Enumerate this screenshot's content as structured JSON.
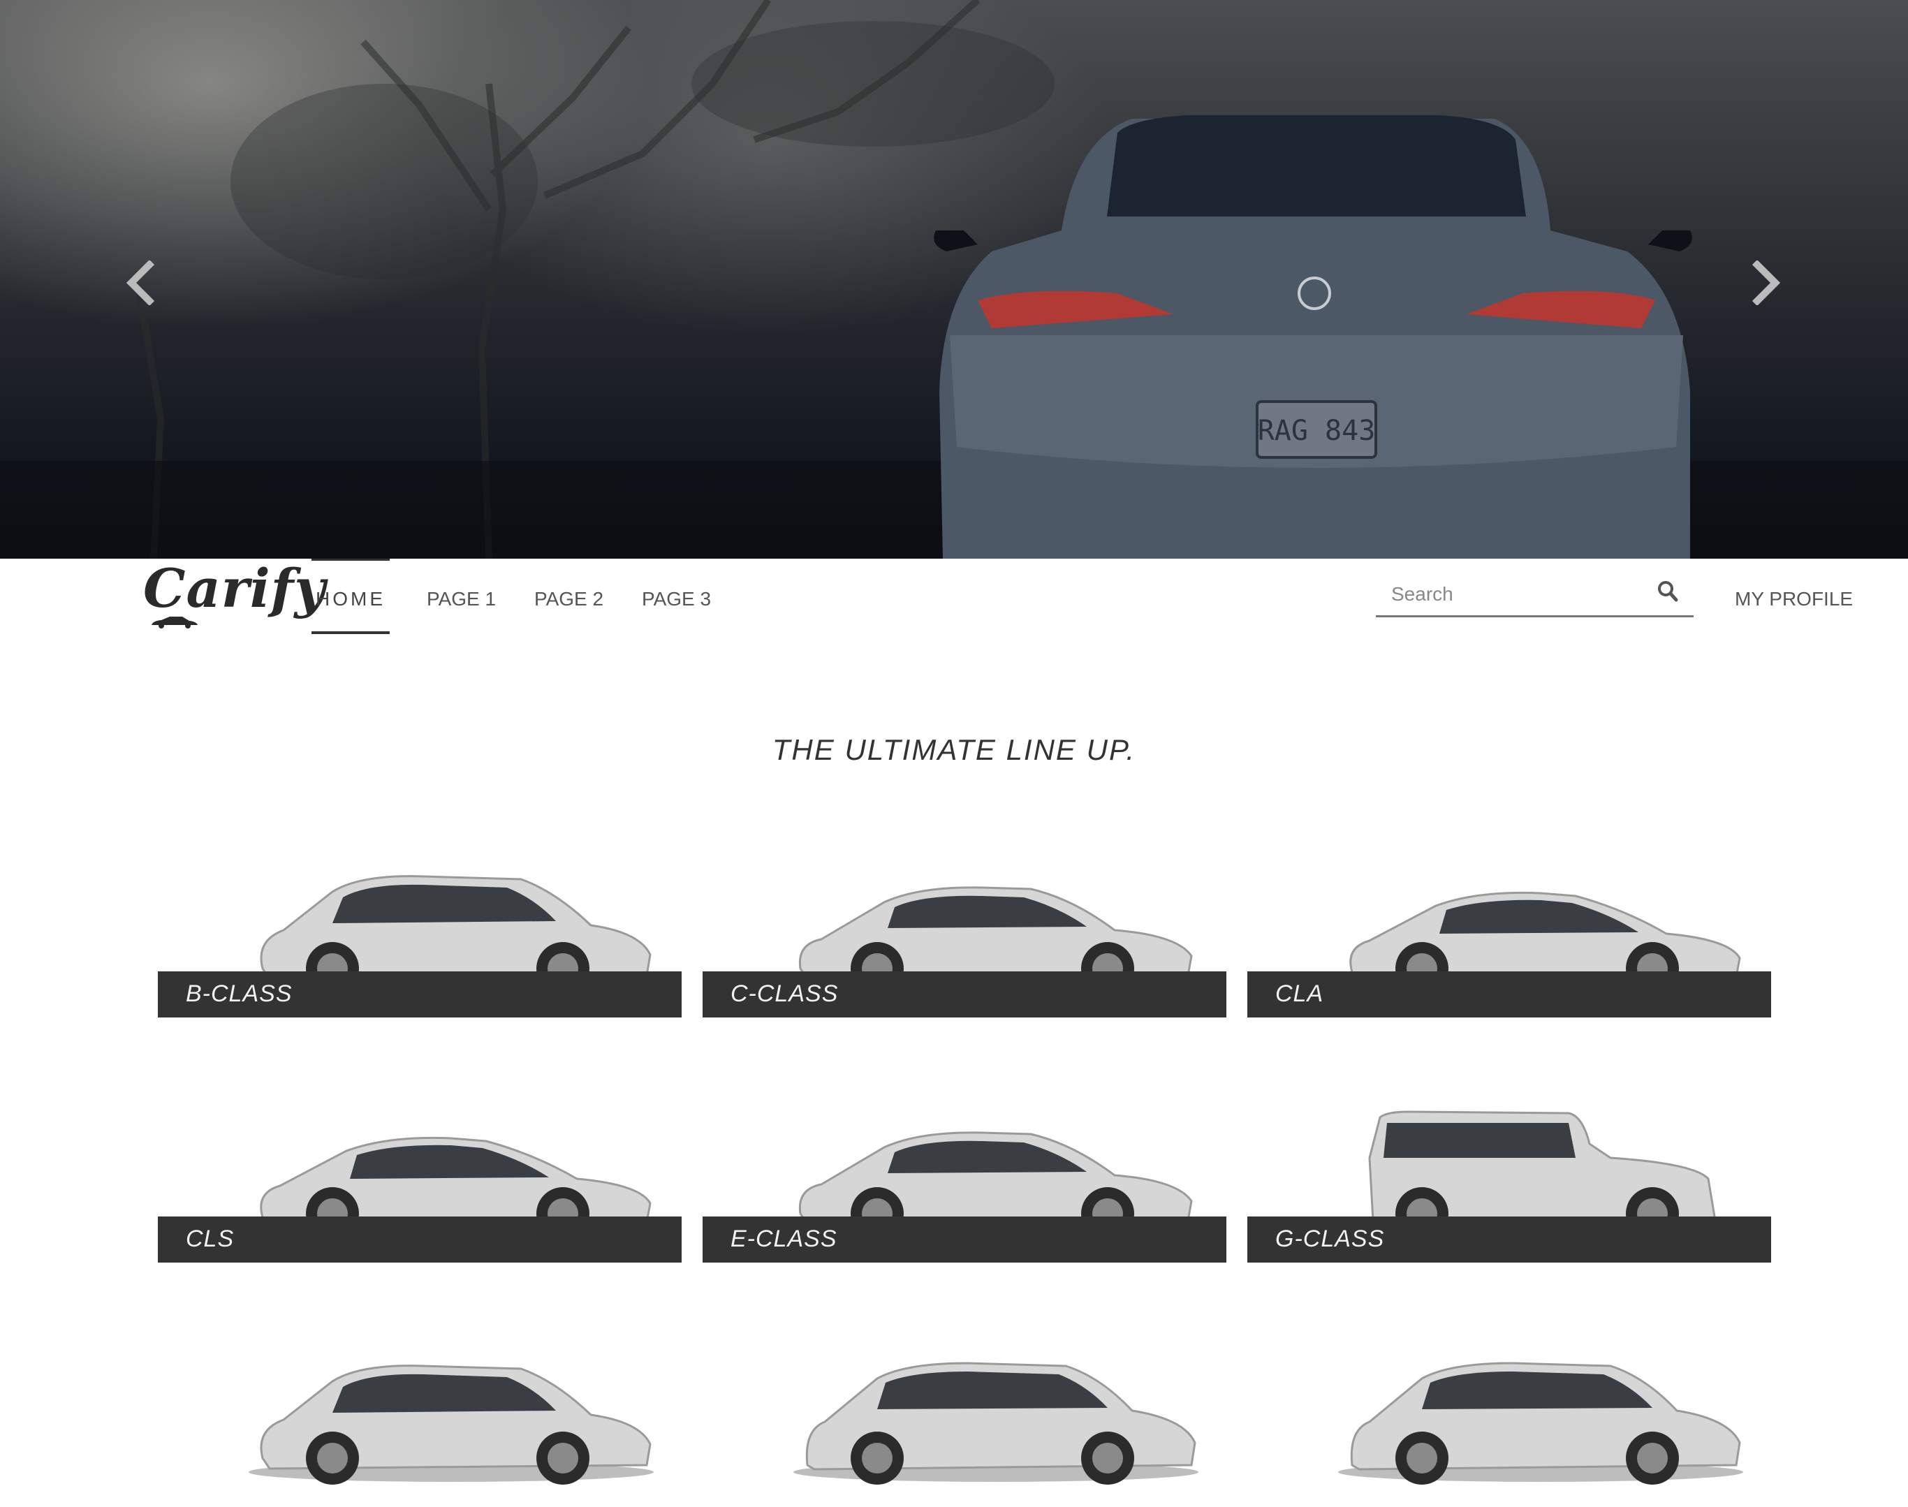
{
  "hero": {
    "plate_text": "RAG 843"
  },
  "brand": {
    "name": "Carify"
  },
  "nav": {
    "items": [
      {
        "label": "HOME"
      },
      {
        "label": "PAGE 1"
      },
      {
        "label": "PAGE 2"
      },
      {
        "label": "PAGE 3"
      }
    ],
    "active": "HOME",
    "profile_label": "MY PROFILE"
  },
  "search": {
    "placeholder": "Search"
  },
  "main": {
    "heading": "THE ULTIMATE LINE UP.",
    "cars": [
      {
        "label": "B-CLASS",
        "shape": "hatch"
      },
      {
        "label": "C-CLASS",
        "shape": "sedan"
      },
      {
        "label": "CLA",
        "shape": "coupe"
      },
      {
        "label": "CLS",
        "shape": "coupe"
      },
      {
        "label": "E-CLASS",
        "shape": "sedan"
      },
      {
        "label": "G-CLASS",
        "shape": "boxy"
      },
      {
        "label": "",
        "shape": "hatch"
      },
      {
        "label": "",
        "shape": "suv"
      },
      {
        "label": "",
        "shape": "suv"
      }
    ]
  },
  "colors": {
    "card_bar": "#333333",
    "car_body": "#d6d6d6"
  },
  "icons": {
    "prev": "chevron-left-icon",
    "next": "chevron-right-icon",
    "search": "search-icon"
  }
}
